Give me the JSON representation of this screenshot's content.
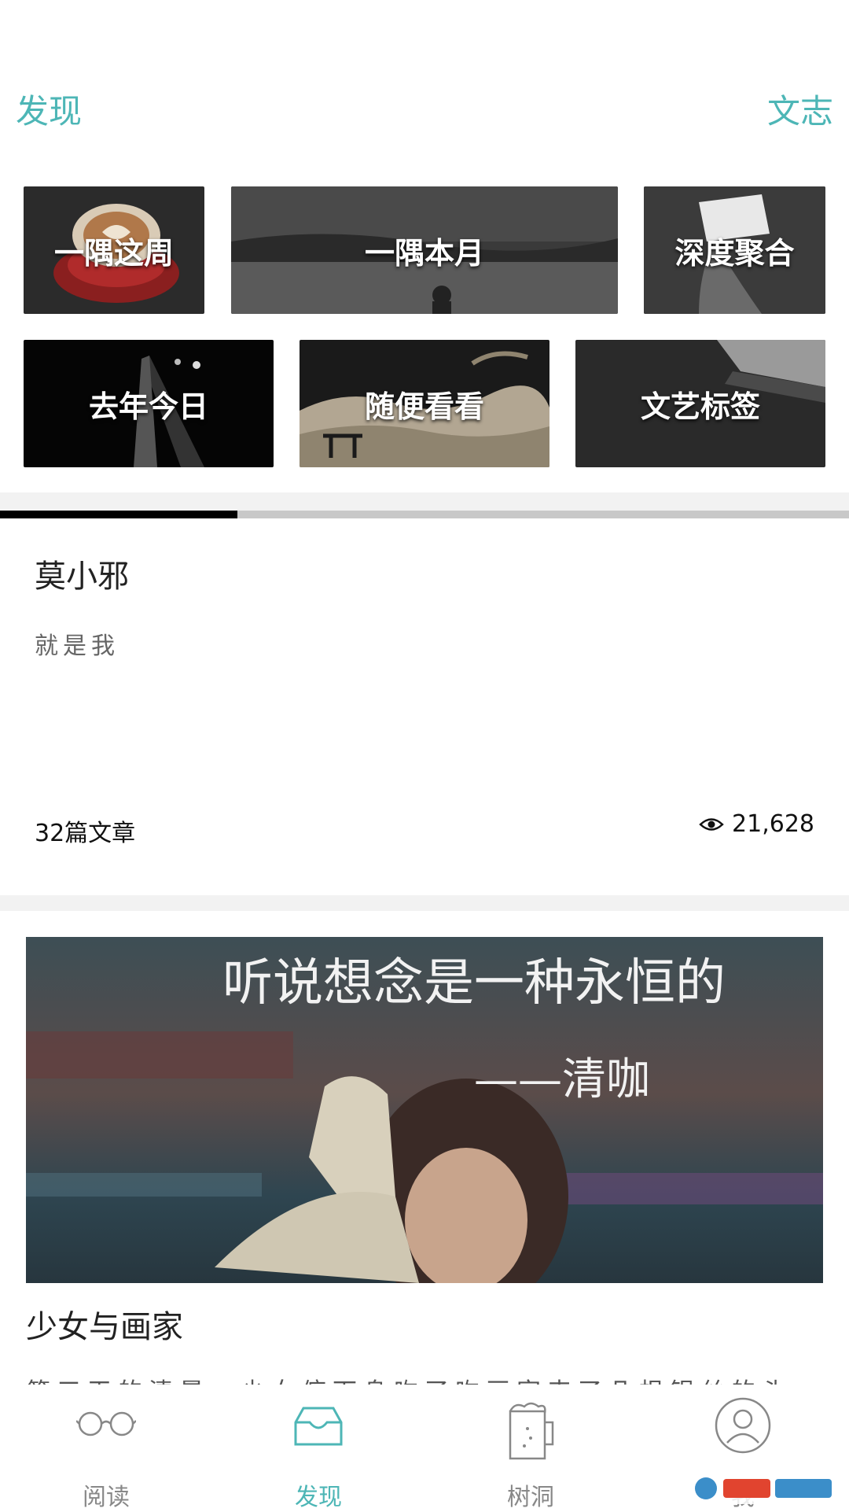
{
  "header": {
    "left_title": "发现",
    "right_title": "文志"
  },
  "categories": [
    {
      "label": "一隅这周"
    },
    {
      "label": "一隅本月"
    },
    {
      "label": "深度聚合"
    },
    {
      "label": "去年今日"
    },
    {
      "label": "随便看看"
    },
    {
      "label": "文艺标签"
    }
  ],
  "carousel": {
    "progress_fraction": 0.28
  },
  "author_card": {
    "name": "莫小邪",
    "bio": "就是我",
    "articles": "32篇文章",
    "views": "21,628",
    "views_icon": "eye-icon"
  },
  "article_card": {
    "image_text_line1": "听说想念是一种永恒的",
    "image_text_line2": "——清咖",
    "title": "少女与画家",
    "excerpt": "第三天的清晨，少女俯下身吻了吻画家来了几根银丝的头"
  },
  "bottom_nav": {
    "items": [
      {
        "label": "阅读",
        "icon": "glasses-icon",
        "active": false
      },
      {
        "label": "发现",
        "icon": "inbox-icon",
        "active": true
      },
      {
        "label": "树洞",
        "icon": "beer-mug-icon",
        "active": false
      },
      {
        "label": "我",
        "icon": "user-icon",
        "active": false
      }
    ]
  },
  "colors": {
    "accent": "#4db6b6",
    "text_primary": "#222222",
    "text_secondary": "#666666"
  }
}
